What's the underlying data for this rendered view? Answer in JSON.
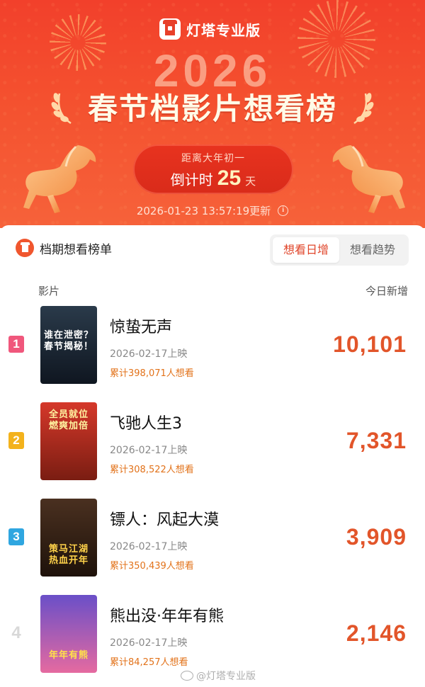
{
  "banner": {
    "app_name": "灯塔专业版",
    "year": "2026",
    "title": "春节档影片想看榜",
    "countdown": {
      "label": "距离大年初一",
      "prefix": "倒计时",
      "days": "25",
      "unit": "天"
    },
    "updated": "2026-01-23 13:57:19更新"
  },
  "panel": {
    "title": "档期想看榜单",
    "tabs": [
      {
        "label": "想看日增",
        "active": true
      },
      {
        "label": "想看趋势",
        "active": false
      }
    ],
    "col_film": "影片",
    "col_new": "今日新增"
  },
  "films": [
    {
      "rank": "1",
      "rank_color": "#f0577c",
      "title": "惊蛰无声",
      "release": "2026-02-17上映",
      "total_want": "累计398,071人想看",
      "today_new": "10,101",
      "poster_text": "谁在泄密？春节揭秘！",
      "poster_colors": [
        "#2a3a4a",
        "#0f1620"
      ]
    },
    {
      "rank": "2",
      "rank_color": "#f3b21c",
      "title": "飞驰人生3",
      "release": "2026-02-17上映",
      "total_want": "累计308,522人想看",
      "today_new": "7,331",
      "poster_text": "全员就位 燃爽加倍",
      "poster_colors": [
        "#d5382a",
        "#7a1d12"
      ]
    },
    {
      "rank": "3",
      "rank_color": "#2fa6e0",
      "title": "镖人：风起大漠",
      "release": "2026-02-17上映",
      "total_want": "累计350,439人想看",
      "today_new": "3,909",
      "poster_text": "策马江湖 热血开年",
      "poster_colors": [
        "#4a3020",
        "#1e120a"
      ]
    },
    {
      "rank": "4",
      "rank_color": "",
      "title": "熊出没·年年有熊",
      "release": "2026-02-17上映",
      "total_want": "累计84,257人想看",
      "today_new": "2,146",
      "poster_text": "年年有熊",
      "poster_colors": [
        "#6a4fc8",
        "#e56aa0"
      ]
    }
  ],
  "watermark": "@灯塔专业版"
}
